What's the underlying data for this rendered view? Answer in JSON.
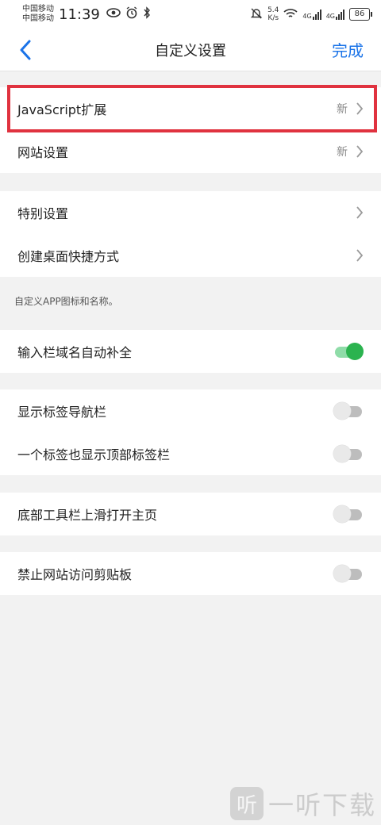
{
  "status_bar": {
    "carrier_1": "中国移动",
    "carrier_2": "中国移动",
    "time": "11:39",
    "net_speed_value": "5.4",
    "net_speed_unit": "K/s",
    "signal_1_label": "4G",
    "signal_2_label": "4G",
    "battery": "86",
    "icons": [
      "eye-icon",
      "alarm-icon",
      "bluetooth-icon",
      "mute-icon",
      "wifi-icon"
    ]
  },
  "nav": {
    "back_icon": "chevron-left-icon",
    "title": "自定义设置",
    "done_label": "完成",
    "accent_color": "#1a73e8"
  },
  "group1": {
    "rows": [
      {
        "label": "JavaScript扩展",
        "badge": "新"
      },
      {
        "label": "网站设置",
        "badge": "新"
      }
    ]
  },
  "group2": {
    "rows": [
      {
        "label": "特别设置"
      },
      {
        "label": "创建桌面快捷方式"
      }
    ],
    "note": "自定义APP图标和名称。"
  },
  "group3": {
    "rows": [
      {
        "label": "输入栏域名自动补全",
        "toggle_on": true
      }
    ]
  },
  "group4": {
    "rows": [
      {
        "label": "显示标签导航栏",
        "toggle_on": false
      },
      {
        "label": "一个标签也显示顶部标签栏",
        "toggle_on": false
      }
    ]
  },
  "group5": {
    "rows": [
      {
        "label": "底部工具栏上滑打开主页",
        "toggle_on": false
      }
    ]
  },
  "group6": {
    "rows": [
      {
        "label": "禁止网站访问剪贴板",
        "toggle_on": false
      }
    ]
  },
  "colors": {
    "highlight_border": "#e0323f",
    "toggle_on": "#2bb34f"
  },
  "watermark": {
    "logo_glyph": "听",
    "text": "一听下载"
  }
}
